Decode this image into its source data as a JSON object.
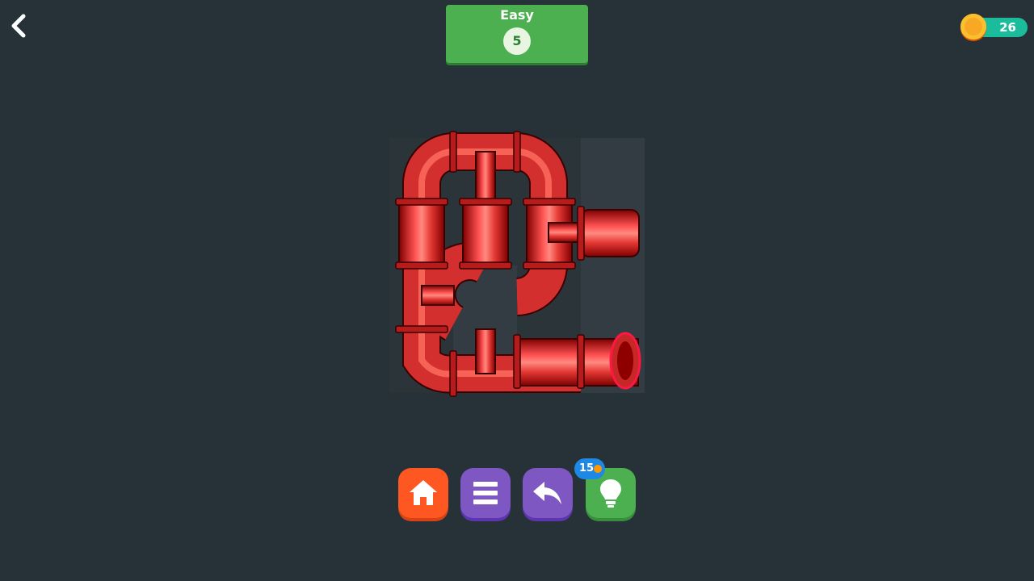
{
  "header": {
    "difficulty": "Easy",
    "level": "5",
    "coins": "26"
  },
  "icons": {
    "back": "chevron-left-icon",
    "coin": "coin-icon",
    "home": "home-icon",
    "menu": "menu-icon",
    "undo": "undo-icon",
    "hint": "lightbulb-icon"
  },
  "toolbar": {
    "hint_cost": "15"
  },
  "colors": {
    "background": "#263238",
    "pipe": "#e53935",
    "level_badge": "#4caf50",
    "coin_pill": "#1abc9c",
    "home_button": "#ff5722",
    "menu_button": "#7e57c2",
    "undo_button": "#7e57c2",
    "hint_button": "#4caf50"
  }
}
